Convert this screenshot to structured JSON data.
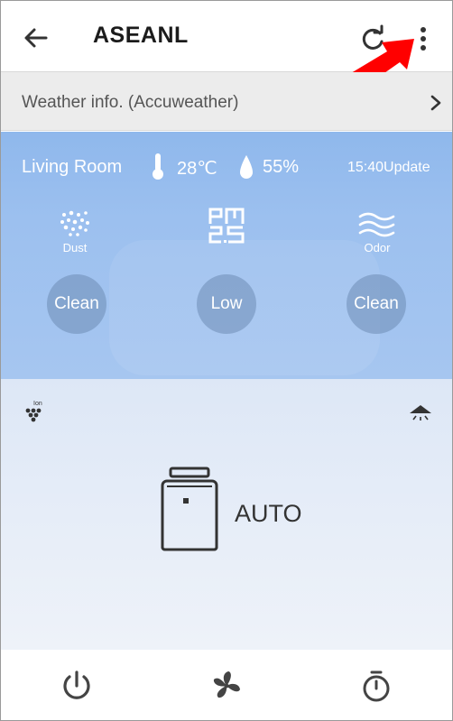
{
  "header": {
    "title": "ASEANL"
  },
  "weather": {
    "label": "Weather info. (Accuweather)"
  },
  "status": {
    "room": "Living Room",
    "temperature": "28℃",
    "humidity": "55%",
    "update": "15:40Update",
    "sensors": [
      {
        "label": "Dust",
        "value": "Clean",
        "icon": "dust-icon"
      },
      {
        "label": "",
        "value": "Low",
        "icon": "pm25-icon"
      },
      {
        "label": "Odor",
        "value": "Clean",
        "icon": "odor-icon"
      }
    ]
  },
  "mode": {
    "ion_label": "Ion",
    "label": "AUTO"
  },
  "colors": {
    "status_panel": "#9cc0ef",
    "badge": "#6e8cb4",
    "arrow": "#ff0000"
  }
}
